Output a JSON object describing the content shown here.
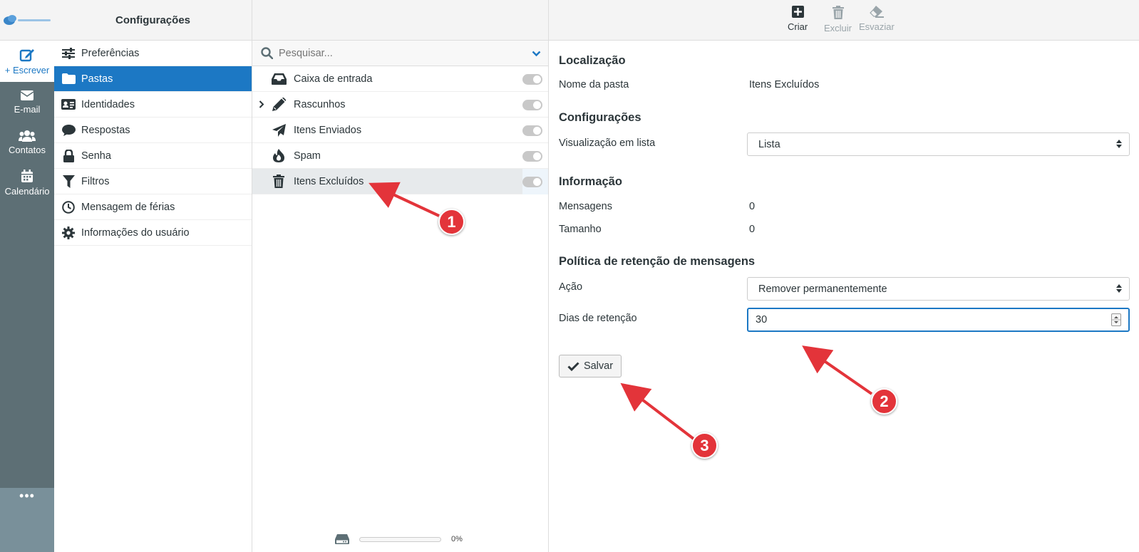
{
  "rail": {
    "compose_label": "+ Escrever",
    "items": [
      {
        "label": "E-mail",
        "icon": "envelope-icon"
      },
      {
        "label": "Contatos",
        "icon": "users-icon"
      },
      {
        "label": "Calendário",
        "icon": "calendar-icon"
      }
    ],
    "more_label": "•••"
  },
  "settings": {
    "title": "Configurações",
    "items": [
      {
        "label": "Preferências",
        "icon": "sliders-icon"
      },
      {
        "label": "Pastas",
        "icon": "folder-icon",
        "active": true
      },
      {
        "label": "Identidades",
        "icon": "id-card-icon"
      },
      {
        "label": "Respostas",
        "icon": "comment-icon"
      },
      {
        "label": "Senha",
        "icon": "lock-icon"
      },
      {
        "label": "Filtros",
        "icon": "filter-icon"
      },
      {
        "label": "Mensagem de férias",
        "icon": "clock-icon"
      },
      {
        "label": "Informações do usuário",
        "icon": "gear-icon"
      }
    ]
  },
  "folders": {
    "search_placeholder": "Pesquisar...",
    "items": [
      {
        "label": "Caixa de entrada",
        "icon": "inbox-icon"
      },
      {
        "label": "Rascunhos",
        "icon": "pencil-icon",
        "expandable": true
      },
      {
        "label": "Itens Enviados",
        "icon": "paper-plane-icon"
      },
      {
        "label": "Spam",
        "icon": "fire-icon"
      },
      {
        "label": "Itens Excluídos",
        "icon": "trash-icon",
        "selected": true
      }
    ],
    "quota_text": "0%"
  },
  "toolbar": {
    "create_label": "Criar",
    "delete_label": "Excluir",
    "empty_label": "Esvaziar"
  },
  "form": {
    "location_title": "Localização",
    "folder_name_label": "Nome da pasta",
    "folder_name_value": "Itens Excluídos",
    "config_title": "Configurações",
    "list_view_label": "Visualização em lista",
    "list_view_value": "Lista",
    "info_title": "Informação",
    "messages_label": "Mensagens",
    "messages_value": "0",
    "size_label": "Tamanho",
    "size_value": "0",
    "retention_title": "Política de retenção de mensagens",
    "action_label": "Ação",
    "action_value": "Remover permanentemente",
    "retention_days_label": "Dias de retenção",
    "retention_days_value": "30",
    "save_label": "Salvar"
  },
  "annotations": [
    "1",
    "2",
    "3"
  ],
  "colors": {
    "accent": "#1c78c4",
    "rail": "#5d6f75",
    "annotation": "#e3343a"
  }
}
